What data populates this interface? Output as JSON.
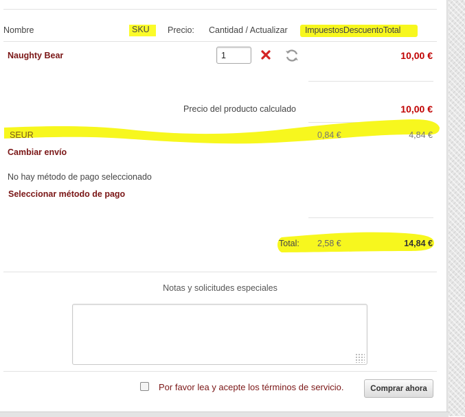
{
  "header": {
    "name": "Nombre",
    "sku": "SKU",
    "price": "Precio:",
    "quantity": "Cantidad / Actualizar",
    "taxes_discount_total": "ImpuestosDescuentoTotal"
  },
  "item": {
    "name": "Naughty Bear",
    "quantity": "1",
    "total": "10,00 €"
  },
  "product_calc": {
    "label": "Precio del producto calculado",
    "value": "10,00 €"
  },
  "shipping": {
    "carrier": "SEUR",
    "tax": "0,84 €",
    "total": "4,84 €",
    "change_link": "Cambiar envío"
  },
  "payment": {
    "none_selected": "No hay método de pago seleccionado",
    "select_link": "Seleccionar método de pago"
  },
  "totals": {
    "label": "Total:",
    "tax": "2,58 €",
    "grand_total": "14,84 €"
  },
  "notes": {
    "label": "Notas y solicitudes especiales",
    "value": ""
  },
  "footer": {
    "terms": "Por favor lea y acepte los términos de servicio.",
    "buy_button": "Comprar ahora"
  },
  "colors": {
    "price_red": "#c00000",
    "link_darkred": "#7a1616",
    "highlight_yellow": "#fbfb2a"
  },
  "icons": [
    "remove-x-icon",
    "refresh-icon"
  ]
}
